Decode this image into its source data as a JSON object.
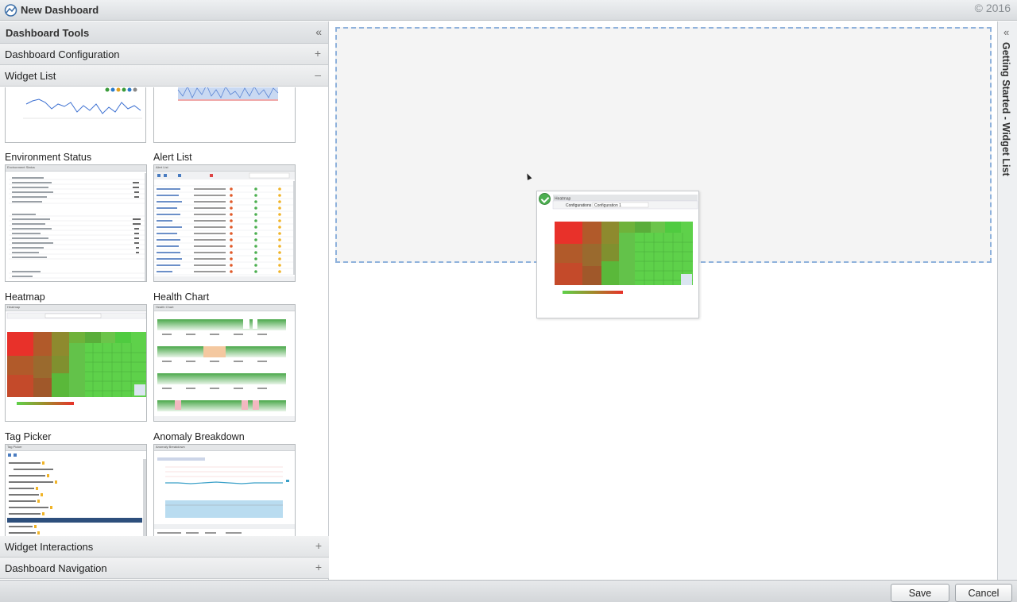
{
  "window": {
    "title": "New Dashboard",
    "copyright": "© 2016"
  },
  "tools": {
    "title": "Dashboard Tools",
    "collapse_glyph": "«",
    "sections": {
      "config": {
        "label": "Dashboard Configuration",
        "toggle": "+"
      },
      "widget_list": {
        "label": "Widget List",
        "toggle": "–"
      },
      "interactions": {
        "label": "Widget Interactions",
        "toggle": "+"
      },
      "navigation": {
        "label": "Dashboard Navigation",
        "toggle": "+"
      }
    }
  },
  "widgets": [
    {
      "label": "Environment Status"
    },
    {
      "label": "Alert List"
    },
    {
      "label": "Heatmap"
    },
    {
      "label": "Health Chart"
    },
    {
      "label": "Tag Picker"
    },
    {
      "label": "Anomaly Breakdown"
    }
  ],
  "thumb_text": {
    "env": "Environment Status",
    "alert": "Alert List",
    "heatmap": "Heatmap",
    "health": "Health Chart",
    "tag": "Tag Picker",
    "anomaly": "Anomaly Breakdown",
    "configurations": "Configurations",
    "configuration_1": "Configuration 1"
  },
  "canvas": {
    "drag_widget_title": "Heatmap",
    "drag_widget_config_label": "Configurations",
    "drag_widget_config_value": "Configuration 1"
  },
  "rail": {
    "title": "Getting Started - Widget List",
    "collapse_glyph": "«"
  },
  "footer": {
    "save": "Save",
    "cancel": "Cancel"
  },
  "colors": {
    "accent_drop": "#8fb2dc",
    "heat_red": "#e8312a",
    "heat_green": "#5ed14a",
    "check": "#4caf50"
  }
}
